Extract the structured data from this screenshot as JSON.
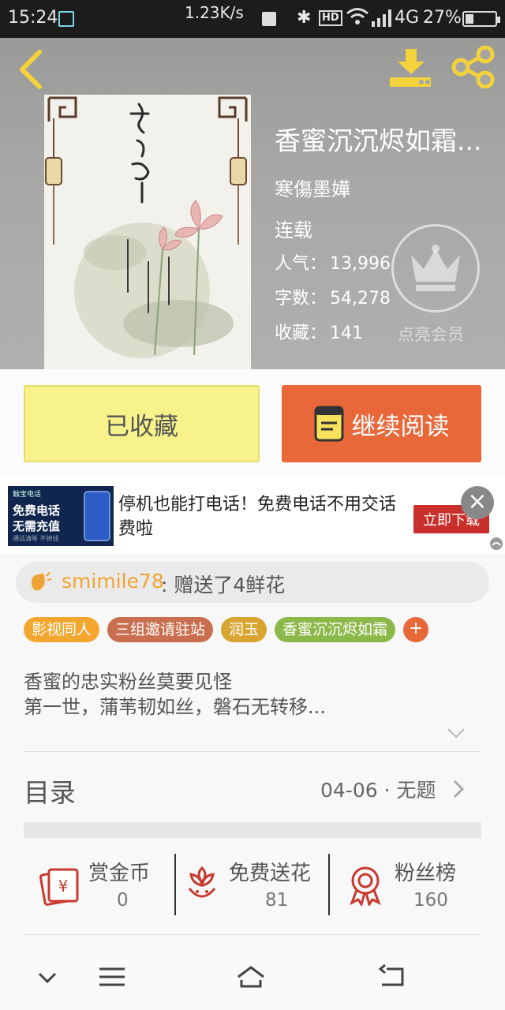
{
  "status_bar": {
    "time": "15:24",
    "net_speed": "1.23K/s",
    "hd": "HD",
    "network": "4G",
    "battery": "27%",
    "battery_level": 0.27
  },
  "book": {
    "title": "香蜜沉沉烬如霜...",
    "author": "寒傷墨嬅",
    "status": "连载",
    "popularity_label": "人气：",
    "popularity": "13,996",
    "words_label": "字数：",
    "words": "54,278",
    "favorites_label": "收藏：",
    "favorites": "141",
    "vip_label": "点亮会员"
  },
  "actions": {
    "favorited": "已收藏",
    "continue": "继续阅读"
  },
  "ad": {
    "image_top": "触宝电话",
    "image_line1": "免费电话",
    "image_line2": "无需充值",
    "image_bottom": "通话清晰 不掉线",
    "text": "停机也能打电话！免费电话不用交话费啦",
    "cta": "立即下载",
    "close": "×"
  },
  "gift": {
    "user": "smimile78",
    "text": ": 赠送了4鲜花"
  },
  "tags": [
    {
      "label": "影视同人",
      "color": "#f3a72f"
    },
    {
      "label": "三组邀请驻站",
      "color": "#c96f4f"
    },
    {
      "label": "润玉",
      "color": "#d9a532"
    },
    {
      "label": "香蜜沉沉烬如霜",
      "color": "#8cb84a"
    }
  ],
  "tag_add": "+",
  "intro": {
    "line1": "香蜜的忠实粉丝莫要见怪",
    "line2": "第一世，蒲苇韧如丝，磐石无转移..."
  },
  "toc": {
    "label": "目录",
    "latest": "04-06 · 无题"
  },
  "stats": [
    {
      "name": "赏金币",
      "value": "0",
      "icon": "reward-coin-icon"
    },
    {
      "name": "免费送花",
      "value": "81",
      "icon": "flower-icon"
    },
    {
      "name": "粉丝榜",
      "value": "160",
      "icon": "medal-icon"
    }
  ],
  "colors": {
    "accent_orange": "#e8683a",
    "favorite_yellow": "#f7f28a",
    "gift_user": "#f0a334"
  }
}
